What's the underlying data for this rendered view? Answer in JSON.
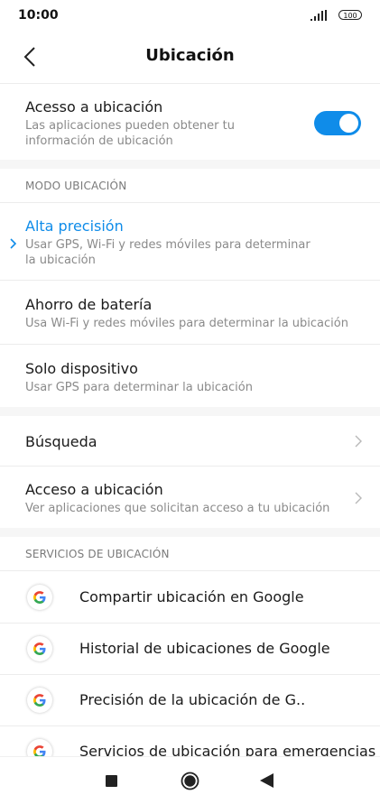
{
  "status": {
    "time": "10:00",
    "battery": "100"
  },
  "header": {
    "title": "Ubicación"
  },
  "location_access": {
    "title": "Acesso a ubicación",
    "subtitle": "Las aplicaciones pueden obtener tu información de ubicación",
    "enabled": true
  },
  "mode": {
    "heading": "MODO UBICACIÓN",
    "items": [
      {
        "title": "Alta precisión",
        "subtitle": "Usar GPS, Wi-Fi y redes móviles para determinar la ubicación",
        "selected": true
      },
      {
        "title": "Ahorro de batería",
        "subtitle": "Usa Wi-Fi y redes móviles para determinar la ubicación",
        "selected": false
      },
      {
        "title": "Solo dispositivo",
        "subtitle": "Usar GPS para determinar la ubicación",
        "selected": false
      }
    ]
  },
  "links": [
    {
      "title": "Búsqueda",
      "subtitle": ""
    },
    {
      "title": "Acceso a ubicación",
      "subtitle": "Ver aplicaciones que solicitan acceso a tu ubicación"
    }
  ],
  "services": {
    "heading": "SERVICIOS DE UBICACIÓN",
    "items": [
      {
        "title": "Compartir ubicación en Google"
      },
      {
        "title": "Historial de ubicaciones de Google"
      },
      {
        "title": "Precisión de la ubicación de G.."
      },
      {
        "title": "Servicios de ubicación para emergencias"
      }
    ]
  },
  "colors": {
    "accent": "#0f8ce9"
  }
}
